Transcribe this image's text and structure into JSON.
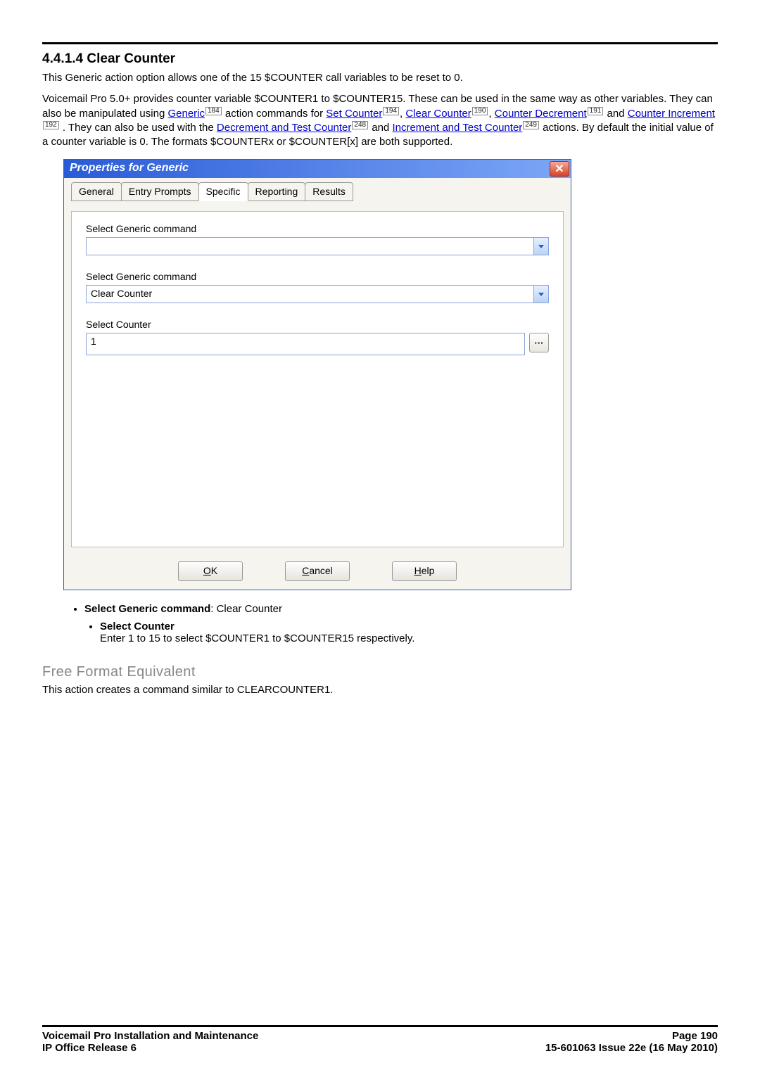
{
  "section": {
    "number": "4.4.1.4",
    "title": "Clear Counter",
    "intro": "This Generic action option allows one of the 15 $COUNTER call variables to be reset to 0.",
    "para2_pre": "Voicemail Pro 5.0+ provides counter variable $COUNTER1 to $COUNTER15. These can be used in the same way as other variables. They can also be manipulated using ",
    "generic_link": "Generic",
    "generic_ref": "184",
    "para2_mid1": " action commands for ",
    "set_counter": "Set Counter",
    "set_counter_ref": "194",
    "clear_counter": "Clear Counter",
    "clear_counter_ref": "190",
    "counter_dec": "Counter Decrement",
    "counter_dec_ref": "191",
    "and1": " and ",
    "counter_inc": "Counter Increment",
    "counter_inc_ref": "192",
    "para2_mid2": ". They can also be used with the ",
    "dec_test": "Decrement and Test Counter",
    "dec_test_ref": "248",
    "and2": " and ",
    "inc_test": "Increment and Test Counter",
    "inc_test_ref": "249",
    "para2_end": " actions. By default the initial value of a counter variable is 0. The formats $COUNTERx or $COUNTER[x] are both supported."
  },
  "dialog": {
    "title": "Properties for Generic",
    "tabs": [
      "General",
      "Entry Prompts",
      "Specific",
      "Reporting",
      "Results"
    ],
    "active_tab": 2,
    "label1": "Select Generic command",
    "combo1_value": "",
    "label2": "Select Generic command",
    "combo2_value": "Clear Counter",
    "label3": "Select Counter",
    "input_value": "1",
    "more": "···",
    "ok": "OK",
    "cancel": "Cancel",
    "help": "Help"
  },
  "bullets": {
    "b1_lead": "Select Generic command",
    "b1_tail": ": Clear Counter",
    "b2_lead": "Select Counter",
    "b2_text": "Enter 1 to 15 to select $COUNTER1 to $COUNTER15 respectively."
  },
  "freeformat": {
    "heading": "Free Format Equivalent",
    "text": "This action creates a command similar to CLEARCOUNTER1."
  },
  "footer": {
    "left1": "Voicemail Pro Installation and Maintenance",
    "left2": "IP Office Release 6",
    "right1": "Page 190",
    "right2": "15-601063 Issue 22e (16 May 2010)"
  }
}
